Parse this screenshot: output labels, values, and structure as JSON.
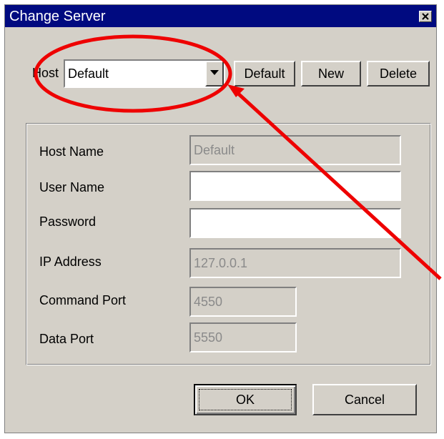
{
  "window": {
    "title": "Change Server",
    "close_icon": "close-icon"
  },
  "host": {
    "label": "Host",
    "selected": "Default",
    "dropdown_icon": "chevron-down-icon"
  },
  "buttons": {
    "default_label": "Default",
    "new_label": "New",
    "delete_label": "Delete",
    "ok_label": "OK",
    "cancel_label": "Cancel"
  },
  "form": {
    "host_name": {
      "label": "Host Name",
      "value": "Default"
    },
    "user_name": {
      "label": "User Name",
      "value": ""
    },
    "password": {
      "label": "Password",
      "value": ""
    },
    "ip_address": {
      "label": "IP Address",
      "value": "127.0.0.1"
    },
    "command_port": {
      "label": "Command Port",
      "value": "4550"
    },
    "data_port": {
      "label": "Data Port",
      "value": "5550"
    }
  },
  "annotation": {
    "color": "#ee0000"
  }
}
